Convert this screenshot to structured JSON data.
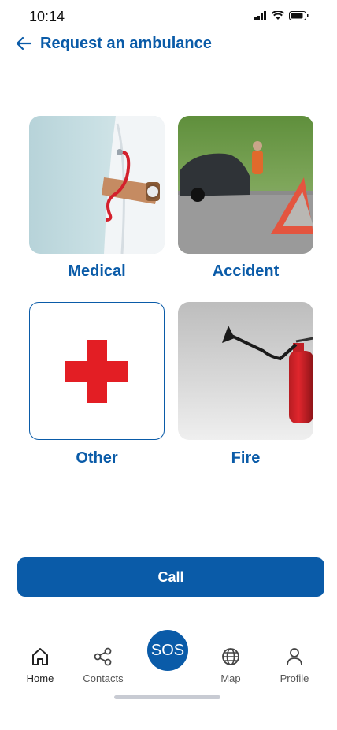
{
  "status": {
    "time": "10:14"
  },
  "header": {
    "title": "Request an ambulance"
  },
  "cards": [
    {
      "label": "Medical"
    },
    {
      "label": "Accident"
    },
    {
      "label": "Other"
    },
    {
      "label": "Fire"
    }
  ],
  "call_label": "Call",
  "nav": {
    "home": "Home",
    "contacts": "Contacts",
    "sos": "SOS",
    "map": "Map",
    "profile": "Profile"
  },
  "colors": {
    "accent": "#0a5ba8",
    "cross": "#e31e24"
  }
}
